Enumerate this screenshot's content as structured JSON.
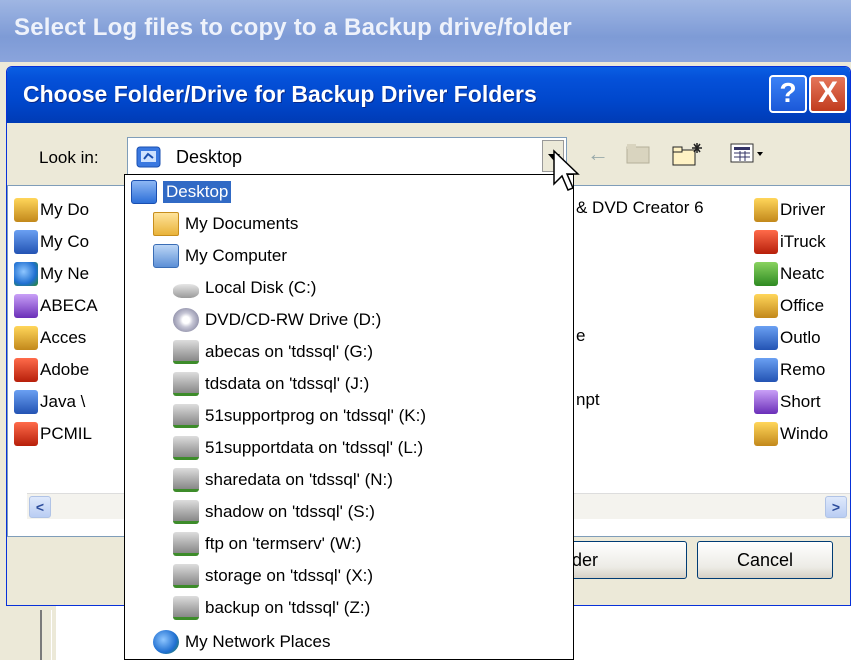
{
  "background_window": {
    "title": "Select Log files to copy to a Backup drive/folder"
  },
  "dialog": {
    "title": "Choose Folder/Drive for Backup Driver Folders",
    "help_label": "?",
    "close_label": "X",
    "look_in_label": "Look in:",
    "look_in_value": "Desktop",
    "ok_label": "lder",
    "cancel_label": "Cancel"
  },
  "file_list": {
    "left_column": [
      {
        "label": "My Do",
        "icon": "docs-folder-icon"
      },
      {
        "label": "My Co",
        "icon": "computer-icon"
      },
      {
        "label": "My Ne",
        "icon": "network-icon"
      },
      {
        "label": "ABECA",
        "icon": "abecas-icon"
      },
      {
        "label": "Acces",
        "icon": "access-icon"
      },
      {
        "label": "Adobe",
        "icon": "adobe-icon"
      },
      {
        "label": "Java \\",
        "icon": "java-icon"
      },
      {
        "label": "PCMIL",
        "icon": "pcmiler-icon"
      }
    ],
    "middle_column": [
      {
        "label": "& DVD Creator 6"
      },
      {
        "label": "e"
      },
      {
        "label": "npt"
      }
    ],
    "right_column": [
      {
        "label": "Driver",
        "icon": "driver-icon"
      },
      {
        "label": "iTruck",
        "icon": "itruck-icon"
      },
      {
        "label": "Neatc",
        "icon": "neat-icon"
      },
      {
        "label": "Office",
        "icon": "office-icon"
      },
      {
        "label": "Outlo",
        "icon": "outlook-icon"
      },
      {
        "label": "Remo",
        "icon": "remote-icon"
      },
      {
        "label": "Short",
        "icon": "shortcut-icon"
      },
      {
        "label": "Windo",
        "icon": "windows-icon"
      }
    ]
  },
  "dropdown": {
    "items": [
      {
        "label": "Desktop",
        "icon": "desktop-icon",
        "selected": true
      },
      {
        "label": "My Documents",
        "icon": "my-documents-icon"
      },
      {
        "label": "My Computer",
        "icon": "my-computer-icon"
      },
      {
        "label": "Local Disk (C:)",
        "icon": "local-disk-icon"
      },
      {
        "label": "DVD/CD-RW Drive (D:)",
        "icon": "dvd-drive-icon"
      },
      {
        "label": "abecas on 'tdssql' (G:)",
        "icon": "network-drive-icon"
      },
      {
        "label": "tdsdata on 'tdssql' (J:)",
        "icon": "network-drive-icon"
      },
      {
        "label": "51supportprog on 'tdssql' (K:)",
        "icon": "network-drive-icon"
      },
      {
        "label": "51supportdata on 'tdssql' (L:)",
        "icon": "network-drive-icon"
      },
      {
        "label": "sharedata on 'tdssql' (N:)",
        "icon": "network-drive-icon"
      },
      {
        "label": "shadow on 'tdssql' (S:)",
        "icon": "network-drive-icon"
      },
      {
        "label": "ftp on 'termserv' (W:)",
        "icon": "network-drive-icon"
      },
      {
        "label": "storage on 'tdssql' (X:)",
        "icon": "network-drive-icon"
      },
      {
        "label": "backup on 'tdssql' (Z:)",
        "icon": "network-drive-icon"
      },
      {
        "label": "My Network Places",
        "icon": "network-places-icon"
      }
    ]
  },
  "colors": {
    "title_bar": "#0054e3",
    "selection": "#316ac5",
    "dialog_bg": "#ece9d8"
  }
}
